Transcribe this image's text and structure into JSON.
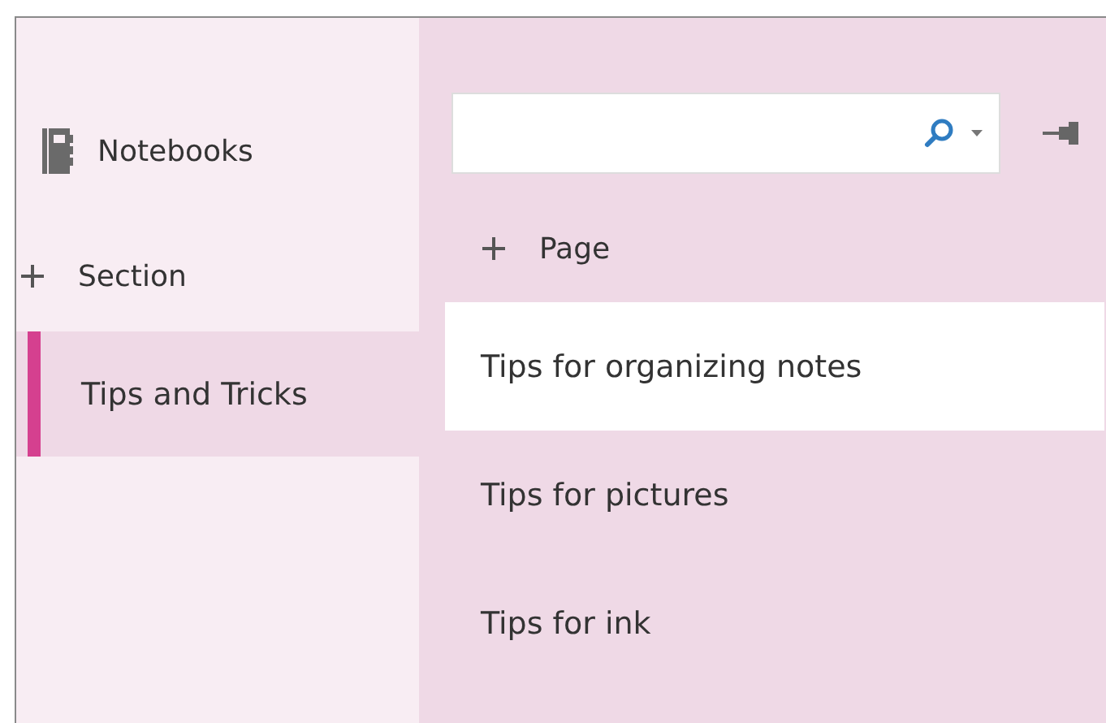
{
  "notebooks": {
    "label": "Notebooks"
  },
  "add_section": {
    "label": "Section"
  },
  "sections": [
    {
      "label": "Tips and Tricks",
      "selected": true
    }
  ],
  "add_page": {
    "label": "Page"
  },
  "pages": [
    {
      "title": "Tips for organizing notes",
      "selected": true
    },
    {
      "title": "Tips for pictures",
      "selected": false
    },
    {
      "title": "Tips for ink",
      "selected": false
    }
  ]
}
